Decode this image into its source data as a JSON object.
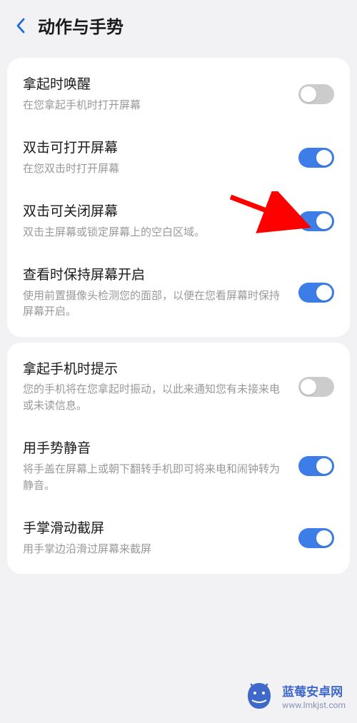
{
  "header": {
    "title": "动作与手势"
  },
  "group1": {
    "items": [
      {
        "title": "拿起时唤醒",
        "subtitle": "在您拿起手机时打开屏幕",
        "enabled": false
      },
      {
        "title": "双击可打开屏幕",
        "subtitle": "在您双击时打开屏幕",
        "enabled": true
      },
      {
        "title": "双击可关闭屏幕",
        "subtitle": "双击主屏幕或锁定屏幕上的空白区域。",
        "enabled": true
      },
      {
        "title": "查看时保持屏幕开启",
        "subtitle": "使用前置摄像头检测您的面部，以便在您看屏幕时保持屏幕开启。",
        "enabled": true
      }
    ]
  },
  "group2": {
    "items": [
      {
        "title": "拿起手机时提示",
        "subtitle": "您的手机将在您拿起时振动，以此来通知您有未接来电或未读信息。",
        "enabled": false
      },
      {
        "title": "用手势静音",
        "subtitle": "将手盖在屏幕上或朝下翻转手机即可将来电和闹钟转为静音。",
        "enabled": true
      },
      {
        "title": "手掌滑动截屏",
        "subtitle": "用手掌边沿滑过屏幕来截屏",
        "enabled": true
      }
    ]
  },
  "watermark": {
    "title": "蓝莓安卓网",
    "url": "www.lmkjst.com"
  }
}
